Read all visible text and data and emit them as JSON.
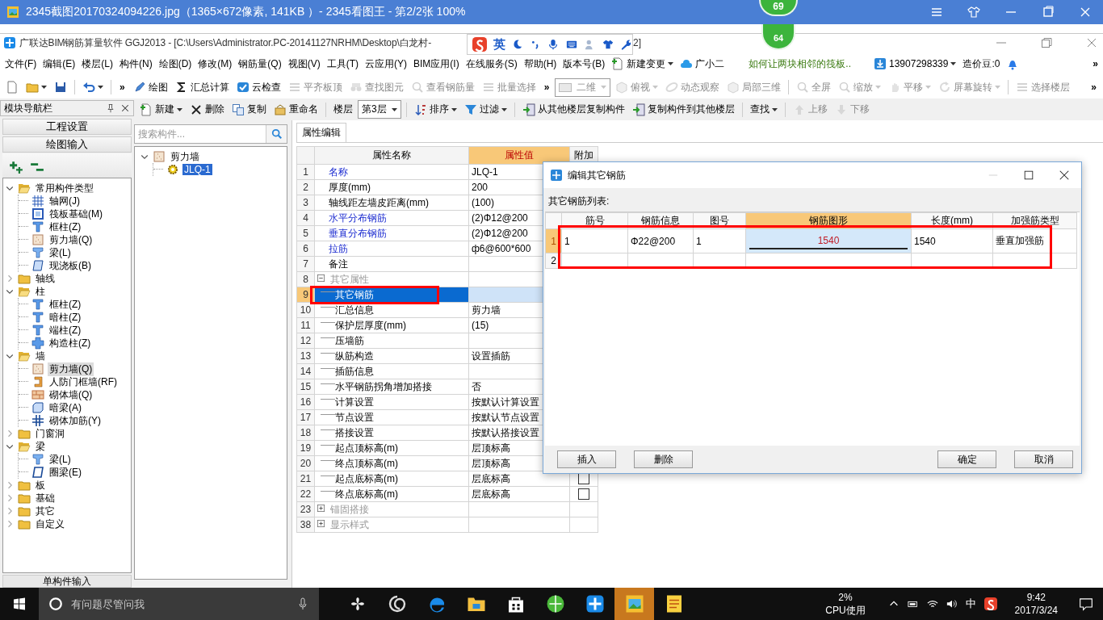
{
  "viewer": {
    "title": "2345截图20170324094226.jpg（1365×672像素, 141KB ）- 2345看图王 - 第2/2张 100%",
    "badge": "69"
  },
  "app": {
    "title": "广联达BIM钢筋算量软件 GGJ2013 - [C:\\Users\\Administrator.PC-20141127NRHM\\Desktop\\白龙村-",
    "title_tail": "2]",
    "badge": "64",
    "ime_lang": "英"
  },
  "menu": {
    "items": [
      "文件(F)",
      "编辑(E)",
      "楼层(L)",
      "构件(N)",
      "绘图(D)",
      "修改(M)",
      "钢筋量(Q)",
      "视图(V)",
      "工具(T)",
      "云应用(Y)",
      "BIM应用(I)",
      "在线服务(S)",
      "帮助(H)",
      "版本号(B)"
    ],
    "extras": [
      {
        "kind": "docplus",
        "label": "新建变更",
        "dropdown": true
      },
      {
        "kind": "cloud",
        "label": "广小二",
        "dropdown": false
      },
      {
        "kind": "notice",
        "label": "如何让两块相邻的筏板..",
        "dropdown": false
      },
      {
        "kind": "account",
        "label": "13907298339",
        "dropdown": true
      },
      {
        "kind": "plain",
        "label": "造价豆:0",
        "dropdown": false
      },
      {
        "kind": "bell",
        "dropdown": false
      },
      {
        "kind": "more",
        "label": "»",
        "dropdown": false
      }
    ]
  },
  "toolbar": [
    {
      "kind": "page",
      "disabled": false,
      "dropdown": false
    },
    {
      "kind": "folder",
      "disabled": false,
      "dropdown": true
    },
    {
      "kind": "floppy",
      "disabled": false,
      "dropdown": false
    },
    {
      "kind": "separator"
    },
    {
      "kind": "undo",
      "disabled": false,
      "dropdown": true
    },
    {
      "kind": "separator"
    },
    {
      "kind": "more",
      "label": "»",
      "disabled": false,
      "dropdown": false
    },
    {
      "kind": "pen",
      "label": "绘图",
      "disabled": false,
      "dropdown": false
    },
    {
      "kind": "sum",
      "label": "汇总计算",
      "disabled": false,
      "dropdown": false
    },
    {
      "kind": "check",
      "label": "云检查",
      "disabled": false,
      "dropdown": false
    },
    {
      "kind": "lines",
      "label": "平齐板顶",
      "disabled": true,
      "dropdown": false
    },
    {
      "kind": "binoculars",
      "label": "查找图元",
      "disabled": true,
      "dropdown": false
    },
    {
      "kind": "magnifier",
      "label": "查看钢筋量",
      "disabled": true,
      "dropdown": false
    },
    {
      "kind": "lines",
      "label": "批量选择",
      "disabled": true,
      "dropdown": false
    },
    {
      "kind": "more",
      "label": "»",
      "disabled": false,
      "dropdown": false
    },
    {
      "kind": "select",
      "label": "二维",
      "disabled": true,
      "dropdown": true
    },
    {
      "kind": "cube",
      "label": "俯视",
      "disabled": true,
      "dropdown": true
    },
    {
      "kind": "orbit",
      "label": "动态观察",
      "disabled": true,
      "dropdown": false
    },
    {
      "kind": "cube",
      "label": "局部三维",
      "disabled": true,
      "dropdown": false
    },
    {
      "kind": "separator"
    },
    {
      "kind": "magnifier",
      "label": "全屏",
      "disabled": true,
      "dropdown": false
    },
    {
      "kind": "magnifier",
      "label": "缩放",
      "disabled": true,
      "dropdown": true
    },
    {
      "kind": "hand",
      "label": "平移",
      "disabled": true,
      "dropdown": true
    },
    {
      "kind": "rotate",
      "label": "屏幕旋转",
      "disabled": true,
      "dropdown": true
    },
    {
      "kind": "separator"
    },
    {
      "kind": "lines",
      "label": "选择楼层",
      "disabled": true,
      "dropdown": false
    },
    {
      "kind": "more",
      "label": "»",
      "disabled": false,
      "dropdown": false
    }
  ],
  "nav": {
    "title": "模块导航栏",
    "buttons": [
      "工程设置",
      "绘图输入"
    ],
    "tree": [
      {
        "label": "常用构件类型",
        "kind": "folder",
        "expanded": true,
        "children": [
          {
            "label": "轴网(J)",
            "kind": "grid",
            "selected": false
          },
          {
            "label": "筏板基础(M)",
            "kind": "raft",
            "selected": false
          },
          {
            "label": "框柱(Z)",
            "kind": "column",
            "selected": false
          },
          {
            "label": "剪力墙(Q)",
            "kind": "shearwall",
            "selected": false
          },
          {
            "label": "梁(L)",
            "kind": "beam",
            "selected": false
          },
          {
            "label": "现浇板(B)",
            "kind": "slab",
            "selected": false
          }
        ]
      },
      {
        "label": "轴线",
        "kind": "folder",
        "expanded": false
      },
      {
        "label": "柱",
        "kind": "folder",
        "expanded": true,
        "children": [
          {
            "label": "框柱(Z)",
            "kind": "column",
            "selected": false
          },
          {
            "label": "暗柱(Z)",
            "kind": "column",
            "selected": false
          },
          {
            "label": "端柱(Z)",
            "kind": "column",
            "selected": false
          },
          {
            "label": "构造柱(Z)",
            "kind": "tiecolumn",
            "selected": false
          }
        ]
      },
      {
        "label": "墙",
        "kind": "folder",
        "expanded": true,
        "children": [
          {
            "label": "剪力墙(Q)",
            "kind": "shearwall",
            "selected": true
          },
          {
            "label": "人防门框墙(RF)",
            "kind": "doorwall",
            "selected": false
          },
          {
            "label": "砌体墙(Q)",
            "kind": "brick",
            "selected": false
          },
          {
            "label": "暗梁(A)",
            "kind": "hiddenbeam",
            "selected": false
          },
          {
            "label": "砌体加筋(Y)",
            "kind": "rebar",
            "selected": false
          }
        ]
      },
      {
        "label": "门窗洞",
        "kind": "folder",
        "expanded": false
      },
      {
        "label": "梁",
        "kind": "folder",
        "expanded": true,
        "children": [
          {
            "label": "梁(L)",
            "kind": "beam",
            "selected": false
          },
          {
            "label": "圈梁(E)",
            "kind": "ringbeam",
            "selected": false
          }
        ]
      },
      {
        "label": "板",
        "kind": "folder",
        "expanded": false
      },
      {
        "label": "基础",
        "kind": "folder",
        "expanded": false
      },
      {
        "label": "其它",
        "kind": "folder",
        "expanded": false
      },
      {
        "label": "自定义",
        "kind": "folder",
        "expanded": false
      }
    ],
    "footer": "单构件输入"
  },
  "toolbar2": [
    {
      "kind": "docplus",
      "label": "新建",
      "disabled": false,
      "dropdown": true
    },
    {
      "kind": "cross",
      "label": "删除",
      "disabled": false,
      "dropdown": false
    },
    {
      "kind": "copy",
      "label": "复制",
      "disabled": false,
      "dropdown": false
    },
    {
      "kind": "rename",
      "label": "重命名",
      "disabled": false,
      "dropdown": false
    },
    {
      "kind": "separator"
    },
    {
      "kind": "text",
      "label": "楼层"
    },
    {
      "kind": "select",
      "label": "第3层",
      "disabled": false,
      "dropdown": true
    },
    {
      "kind": "separator"
    },
    {
      "kind": "sort",
      "label": "排序",
      "disabled": false,
      "dropdown": true
    },
    {
      "kind": "funnel",
      "label": "过滤",
      "disabled": false,
      "dropdown": true
    },
    {
      "kind": "separator"
    },
    {
      "kind": "transfer",
      "label": "从其他楼层复制构件",
      "disabled": false,
      "dropdown": false
    },
    {
      "kind": "transfer",
      "label": "复制构件到其他楼层",
      "disabled": false,
      "dropdown": false
    },
    {
      "kind": "separator"
    },
    {
      "kind": "plain",
      "label": "查找",
      "disabled": false,
      "dropdown": true
    },
    {
      "kind": "separator"
    },
    {
      "kind": "up",
      "label": "上移",
      "disabled": true,
      "dropdown": false
    },
    {
      "kind": "down",
      "label": "下移",
      "disabled": true,
      "dropdown": false
    }
  ],
  "components": {
    "search": {
      "placeholder": "搜索构件..."
    },
    "tree": [
      {
        "label": "剪力墙",
        "kind": "shearwall",
        "expanded": true,
        "children": [
          {
            "label": "JLQ-1",
            "kind": "gear",
            "selected": true
          }
        ]
      }
    ]
  },
  "properties": {
    "tab": "属性编辑",
    "columns": [
      {
        "label": "属性名称",
        "selected": false
      },
      {
        "label": "属性值",
        "selected": true
      },
      {
        "label": "附加",
        "selected": false
      }
    ],
    "rows": [
      {
        "num": "1",
        "kind": "property",
        "name": "名称",
        "value": "JLQ-1",
        "link": true,
        "selected": false
      },
      {
        "num": "2",
        "kind": "property",
        "name": "厚度(mm)",
        "value": "200",
        "link": false,
        "selected": false
      },
      {
        "num": "3",
        "kind": "property",
        "name": "轴线距左墙皮距离(mm)",
        "value": "(100)",
        "link": false,
        "selected": false
      },
      {
        "num": "4",
        "kind": "property",
        "name": "水平分布钢筋",
        "value": "(2)Φ12@200",
        "link": true,
        "selected": false
      },
      {
        "num": "5",
        "kind": "property",
        "name": "垂直分布钢筋",
        "value": "(2)Φ12@200",
        "link": true,
        "selected": false
      },
      {
        "num": "6",
        "kind": "property",
        "name": "拉筋",
        "value": "ф6@600*600",
        "link": true,
        "selected": false
      },
      {
        "num": "7",
        "kind": "property",
        "name": "备注",
        "link": false,
        "selected": false
      },
      {
        "num": "8",
        "kind": "group",
        "name": "其它属性",
        "expanded": true,
        "selected": false,
        "children": [
          {
            "num": "9",
            "kind": "property",
            "name": "其它钢筋",
            "link": false,
            "selected": true
          },
          {
            "num": "10",
            "kind": "property",
            "name": "汇总信息",
            "value": "剪力墙",
            "link": false,
            "selected": false
          },
          {
            "num": "11",
            "kind": "property",
            "name": "保护层厚度(mm)",
            "value": "(15)",
            "link": false,
            "selected": false
          },
          {
            "num": "12",
            "kind": "property",
            "name": "压墙筋",
            "link": false,
            "selected": false
          },
          {
            "num": "13",
            "kind": "property",
            "name": "纵筋构造",
            "value": "设置插筋",
            "link": false,
            "selected": false
          },
          {
            "num": "14",
            "kind": "property",
            "name": "插筋信息",
            "link": false,
            "selected": false
          },
          {
            "num": "15",
            "kind": "property",
            "name": "水平钢筋拐角增加搭接",
            "value": "否",
            "link": false,
            "selected": false
          },
          {
            "num": "16",
            "kind": "property",
            "name": "计算设置",
            "value": "按默认计算设置",
            "link": false,
            "selected": false
          },
          {
            "num": "17",
            "kind": "property",
            "name": "节点设置",
            "value": "按默认节点设置",
            "link": false,
            "selected": false
          },
          {
            "num": "18",
            "kind": "property",
            "name": "搭接设置",
            "value": "按默认搭接设置",
            "link": false,
            "selected": false
          },
          {
            "num": "19",
            "kind": "property",
            "name": "起点顶标高(m)",
            "value": "层顶标高",
            "link": false,
            "selected": false
          },
          {
            "num": "20",
            "kind": "property",
            "name": "终点顶标高(m)",
            "value": "层顶标高",
            "link": false,
            "selected": false
          },
          {
            "num": "21",
            "kind": "property",
            "name": "起点底标高(m)",
            "value": "层底标高",
            "link": false,
            "selected": false,
            "checked": false
          },
          {
            "num": "22",
            "kind": "property",
            "name": "终点底标高(m)",
            "value": "层底标高",
            "link": false,
            "selected": false,
            "checked": false
          }
        ]
      },
      {
        "num": "23",
        "kind": "group",
        "name": "锚固搭接",
        "expanded": false,
        "selected": false
      },
      {
        "num": "38",
        "kind": "group",
        "name": "显示样式",
        "expanded": false,
        "selected": false
      }
    ]
  },
  "dialog": {
    "title": "编辑其它钢筋",
    "list_label": "其它钢筋列表:",
    "columns": [
      {
        "label": "筋号",
        "selected": false
      },
      {
        "label": "钢筋信息",
        "selected": false
      },
      {
        "label": "图号",
        "selected": false
      },
      {
        "label": "钢筋图形",
        "selected": true
      },
      {
        "label": "长度(mm)",
        "selected": false
      },
      {
        "label": "加强筋类型",
        "selected": false
      }
    ],
    "rows": [
      {
        "num": "1",
        "selected": true,
        "cells": [
          "1",
          "Φ22@200",
          "1",
          "1540",
          "1540",
          "垂直加强筋"
        ]
      },
      {
        "num": "2",
        "selected": false
      }
    ],
    "buttons": [
      "插入",
      "删除",
      "确定",
      "取消"
    ]
  },
  "taskbar": {
    "search": {
      "placeholder": "有问题尽管问我"
    },
    "apps": [
      {
        "kind": "pinwheel",
        "active": false
      },
      {
        "kind": "swirl",
        "active": false
      },
      {
        "kind": "browser",
        "active": false
      },
      {
        "kind": "explorer",
        "active": false
      },
      {
        "kind": "store",
        "active": false
      },
      {
        "kind": "globe",
        "active": false
      },
      {
        "kind": "crossapp",
        "active": false
      },
      {
        "kind": "viewer",
        "active": true
      },
      {
        "kind": "notepad",
        "active": false
      }
    ],
    "cpu": {
      "value": "2%",
      "label": "CPU使用"
    },
    "ime_lang": "中",
    "time": "9:42",
    "date": "2017/3/24"
  }
}
